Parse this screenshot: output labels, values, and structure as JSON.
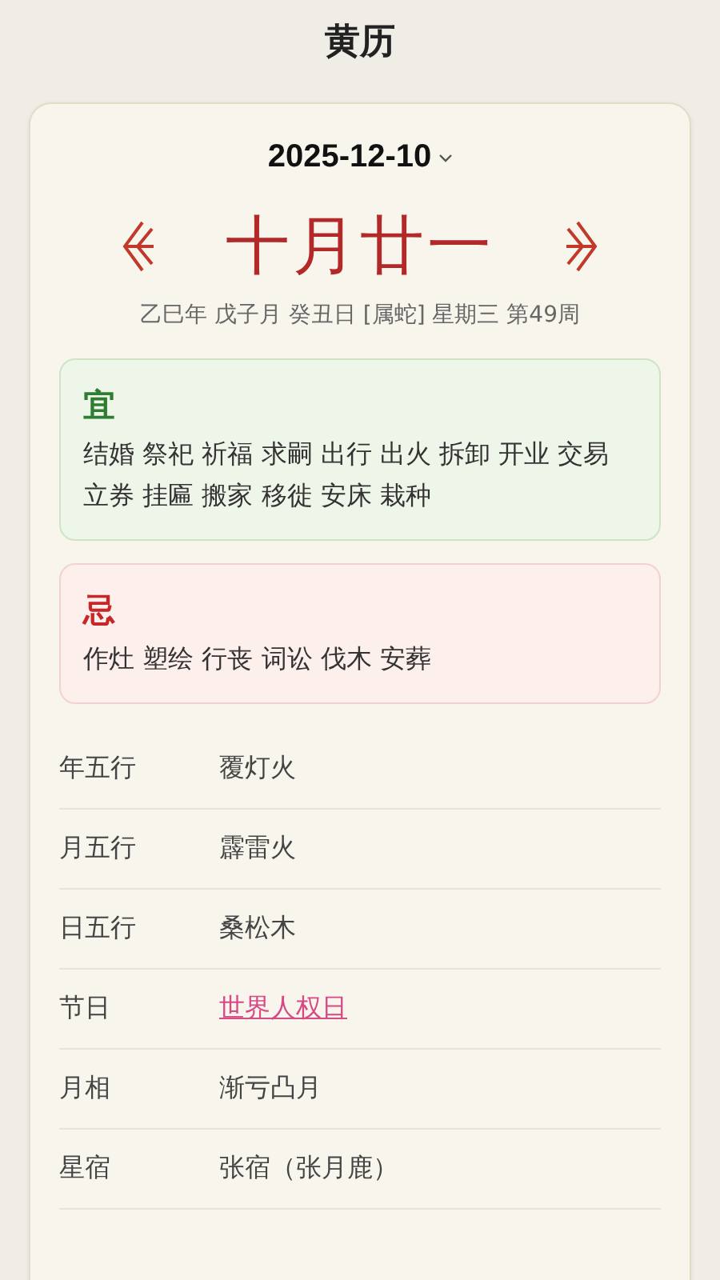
{
  "header": {
    "title": "黄历"
  },
  "date": {
    "value": "2025-12-10"
  },
  "lunar": {
    "date": "十月廿一",
    "detail": "乙巳年 戊子月 癸丑日 [属蛇] 星期三 第49周"
  },
  "advice": [
    {
      "kind": "good",
      "heading": "宜",
      "items": [
        "结婚",
        "祭祀",
        "祈福",
        "求嗣",
        "出行",
        "出火",
        "拆卸",
        "开业",
        "交易",
        "立券",
        "挂匾",
        "搬家",
        "移徙",
        "安床",
        "栽种"
      ]
    },
    {
      "kind": "bad",
      "heading": "忌",
      "items": [
        "作灶",
        "塑绘",
        "行丧",
        "词讼",
        "伐木",
        "安葬"
      ]
    }
  ],
  "details": [
    {
      "kind": "text",
      "label": "年五行",
      "value": "覆灯火"
    },
    {
      "kind": "text",
      "label": "月五行",
      "value": "霹雷火"
    },
    {
      "kind": "text",
      "label": "日五行",
      "value": "桑松木"
    },
    {
      "kind": "link",
      "label": "节日",
      "value": "世界人权日"
    },
    {
      "kind": "text",
      "label": "月相",
      "value": "渐亏凸月"
    },
    {
      "kind": "text",
      "label": "星宿",
      "value": "张宿（张月鹿）"
    }
  ]
}
